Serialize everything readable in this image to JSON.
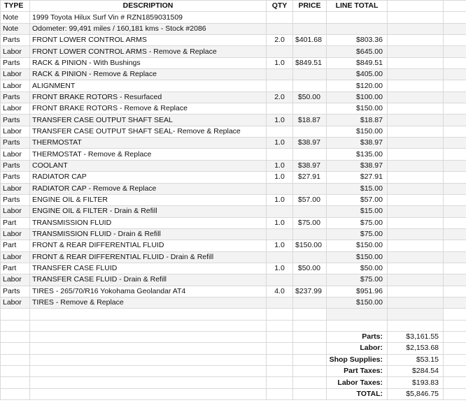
{
  "headers": {
    "type": "TYPE",
    "description": "DESCRIPTION",
    "qty": "QTY",
    "price": "PRICE",
    "line_total": "LINE TOTAL"
  },
  "rows": [
    {
      "type": "Note",
      "description": "1999 Toyota Hilux Surf Vin # RZN1859031509",
      "qty": "",
      "price": "",
      "total": ""
    },
    {
      "type": "Note",
      "description": "Odometer: 99,491 miles / 160,181 kms - Stock #2086",
      "qty": "",
      "price": "",
      "total": ""
    },
    {
      "type": "Parts",
      "description": "FRONT LOWER CONTROL ARMS",
      "qty": "2.0",
      "price": "$401.68",
      "total": "$803.36"
    },
    {
      "type": "Labor",
      "description": "FRONT LOWER CONTROL ARMS - Remove & Replace",
      "qty": "",
      "price": "",
      "total": "$645.00"
    },
    {
      "type": "Parts",
      "description": "RACK & PINION - With Bushings",
      "qty": "1.0",
      "price": "$849.51",
      "total": "$849.51"
    },
    {
      "type": "Labor",
      "description": "RACK & PINION - Remove & Replace",
      "qty": "",
      "price": "",
      "total": "$405.00"
    },
    {
      "type": "Labor",
      "description": "ALIGNMENT",
      "qty": "",
      "price": "",
      "total": "$120.00"
    },
    {
      "type": "Parts",
      "description": "FRONT BRAKE ROTORS - Resurfaced",
      "qty": "2.0",
      "price": "$50.00",
      "total": "$100.00"
    },
    {
      "type": "Labor",
      "description": "FRONT BRAKE ROTORS - Remove & Replace",
      "qty": "",
      "price": "",
      "total": "$150.00"
    },
    {
      "type": "Parts",
      "description": "TRANSFER CASE OUTPUT SHAFT SEAL",
      "qty": "1.0",
      "price": "$18.87",
      "total": "$18.87"
    },
    {
      "type": "Labor",
      "description": "TRANSFER CASE OUTPUT SHAFT SEAL- Remove & Replace",
      "qty": "",
      "price": "",
      "total": "$150.00"
    },
    {
      "type": "Parts",
      "description": "THERMOSTAT",
      "qty": "1.0",
      "price": "$38.97",
      "total": "$38.97"
    },
    {
      "type": "Labor",
      "description": "THERMOSTAT - Remove & Replace",
      "qty": "",
      "price": "",
      "total": "$135.00"
    },
    {
      "type": "Parts",
      "description": "COOLANT",
      "qty": "1.0",
      "price": "$38.97",
      "total": "$38.97"
    },
    {
      "type": "Parts",
      "description": "RADIATOR CAP",
      "qty": "1.0",
      "price": "$27.91",
      "total": "$27.91"
    },
    {
      "type": "Labor",
      "description": "RADIATOR CAP - Remove & Replace",
      "qty": "",
      "price": "",
      "total": "$15.00"
    },
    {
      "type": "Parts",
      "description": "ENGINE OIL & FILTER",
      "qty": "1.0",
      "price": "$57.00",
      "total": "$57.00"
    },
    {
      "type": "Labor",
      "description": "ENGINE OIL & FILTER - Drain & Refill",
      "qty": "",
      "price": "",
      "total": "$15.00"
    },
    {
      "type": "Part",
      "description": "TRANSMISSION FLUID",
      "qty": "1.0",
      "price": "$75.00",
      "total": "$75.00"
    },
    {
      "type": "Labor",
      "description": "TRANSMISSION FLUID - Drain & Refill",
      "qty": "",
      "price": "",
      "total": "$75.00"
    },
    {
      "type": "Part",
      "description": "FRONT & REAR DIFFERENTIAL FLUID",
      "qty": "1.0",
      "price": "$150.00",
      "total": "$150.00"
    },
    {
      "type": "Labor",
      "description": "FRONT & REAR DIFFERENTIAL FLUID - Drain & Refill",
      "qty": "",
      "price": "",
      "total": "$150.00"
    },
    {
      "type": "Part",
      "description": "TRANSFER CASE FLUID",
      "qty": "1.0",
      "price": "$50.00",
      "total": "$50.00"
    },
    {
      "type": "Labor",
      "description": "TRANSFER CASE FLUID - Drain & Refill",
      "qty": "",
      "price": "",
      "total": "$75.00"
    },
    {
      "type": "Parts",
      "description": "TIRES - 265/70/R16 Yokohama Geolandar AT4",
      "qty": "4.0",
      "price": "$237.99",
      "total": "$951.96"
    },
    {
      "type": "Labor",
      "description": "TIRES - Remove & Replace",
      "qty": "",
      "price": "",
      "total": "$150.00"
    }
  ],
  "summary": [
    {
      "label": "Parts:",
      "value": "$3,161.55"
    },
    {
      "label": "Labor:",
      "value": "$2,153.68"
    },
    {
      "label": "Shop Supplies:",
      "value": "$53.15"
    },
    {
      "label": "Part Taxes:",
      "value": "$284.54"
    },
    {
      "label": "Labor Taxes:",
      "value": "$193.83"
    },
    {
      "label": "TOTAL:",
      "value": "$5,846.75"
    }
  ]
}
